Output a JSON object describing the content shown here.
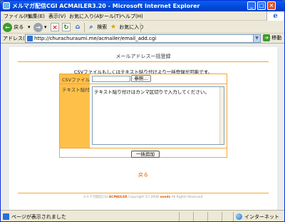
{
  "window": {
    "title": "メルマガ配信CGI ACMAILER3.20 - Microsoft Internet Explorer",
    "controls": {
      "minimize": "_",
      "maximize": "□",
      "close": "×"
    }
  },
  "menubar": {
    "items": [
      "ファイル(F)",
      "編集(E)",
      "表示(V)",
      "お気に入り(A)",
      "ツール(T)",
      "ヘルプ(H)"
    ]
  },
  "toolbar": {
    "back_label": "戻る",
    "search_label": "検索",
    "favorites_label": "お気に入り"
  },
  "addressbar": {
    "label": "アドレス(D)",
    "url": "http://churachuraumi.me/acmailer/email_add.cgi",
    "go_label": "移動"
  },
  "page": {
    "title": "メールアドレス一括登録",
    "intro": "CSVファイルもしくはテキスト貼り付けより一括登録が可能です。",
    "form": {
      "csv_label": "CSVファイル",
      "browse_label": "参照...",
      "text_label": "テキスト貼付",
      "text_value": "テキスト貼り付けはカンマ区切りで入力してください。",
      "submit_label": "一括追加"
    },
    "back_link": "戻る",
    "footer": {
      "prefix": "メルマガ配信CGI",
      "brand": "ACMAILER",
      "copyright": "Copyright (C) 2008",
      "company": "seeds",
      "rights": "All Rights Reserved."
    }
  },
  "statusbar": {
    "text": "ページが表示されました",
    "zone": "インターネット"
  },
  "colors": {
    "accent": "#f0a830",
    "label_bg": "#ffc04a",
    "link": "#e06000",
    "titlebar": "#0048d8"
  }
}
